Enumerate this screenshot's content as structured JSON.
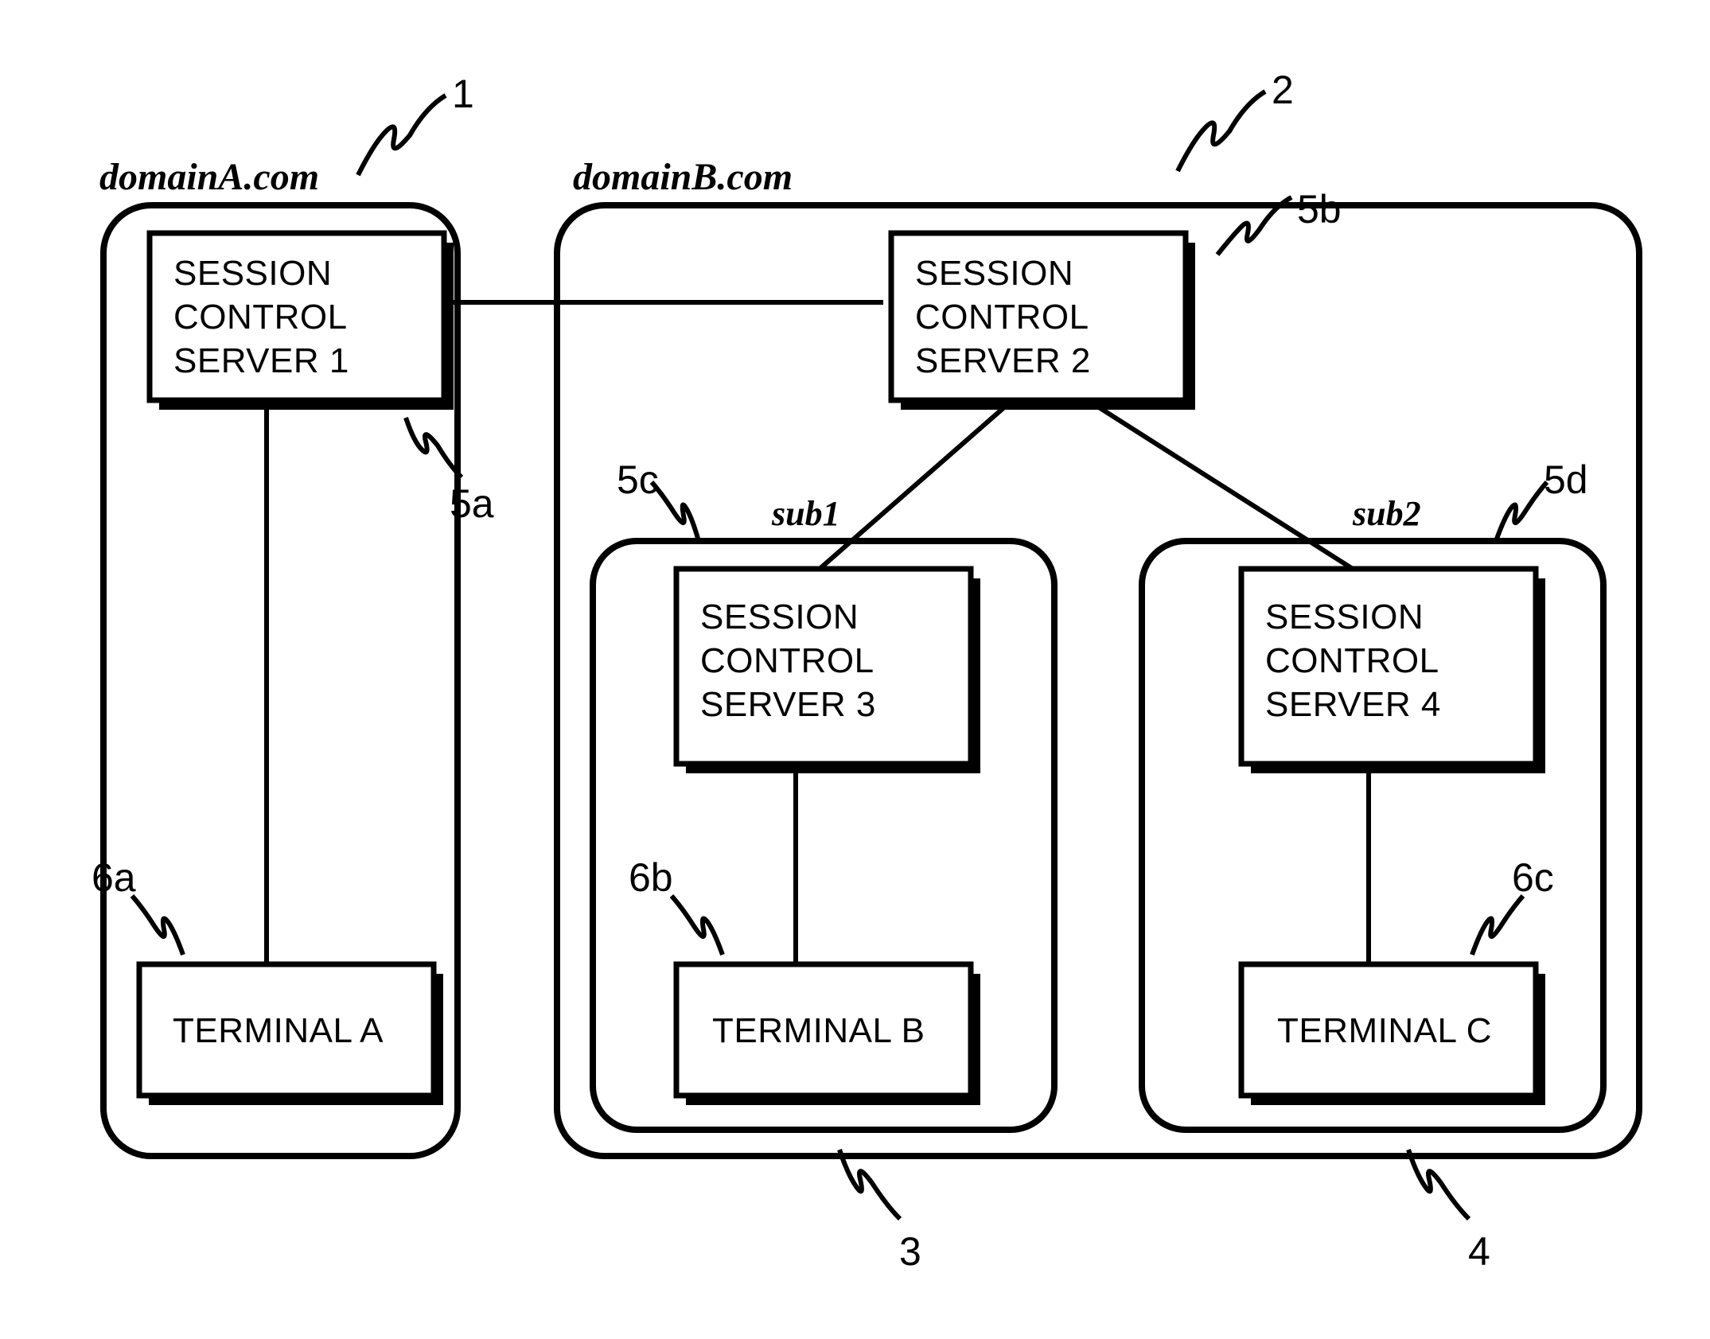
{
  "domains": {
    "A": {
      "title": "domainA.com",
      "ref": "1"
    },
    "B": {
      "title": "domainB.com",
      "ref": "2"
    }
  },
  "subdomains": {
    "sub1": {
      "title": "sub1",
      "ref": "3"
    },
    "sub2": {
      "title": "sub2",
      "ref": "4"
    }
  },
  "servers": {
    "s1": {
      "line1": "SESSION",
      "line2": "CONTROL",
      "line3": "SERVER 1",
      "ref": "5a"
    },
    "s2": {
      "line1": "SESSION",
      "line2": "CONTROL",
      "line3": "SERVER 2",
      "ref": "5b"
    },
    "s3": {
      "line1": "SESSION",
      "line2": "CONTROL",
      "line3": "SERVER 3",
      "ref": "5c"
    },
    "s4": {
      "line1": "SESSION",
      "line2": "CONTROL",
      "line3": "SERVER 4",
      "ref": "5d"
    }
  },
  "terminals": {
    "tA": {
      "label": "TERMINAL A",
      "ref": "6a"
    },
    "tB": {
      "label": "TERMINAL B",
      "ref": "6b"
    },
    "tC": {
      "label": "TERMINAL C",
      "ref": "6c"
    }
  }
}
